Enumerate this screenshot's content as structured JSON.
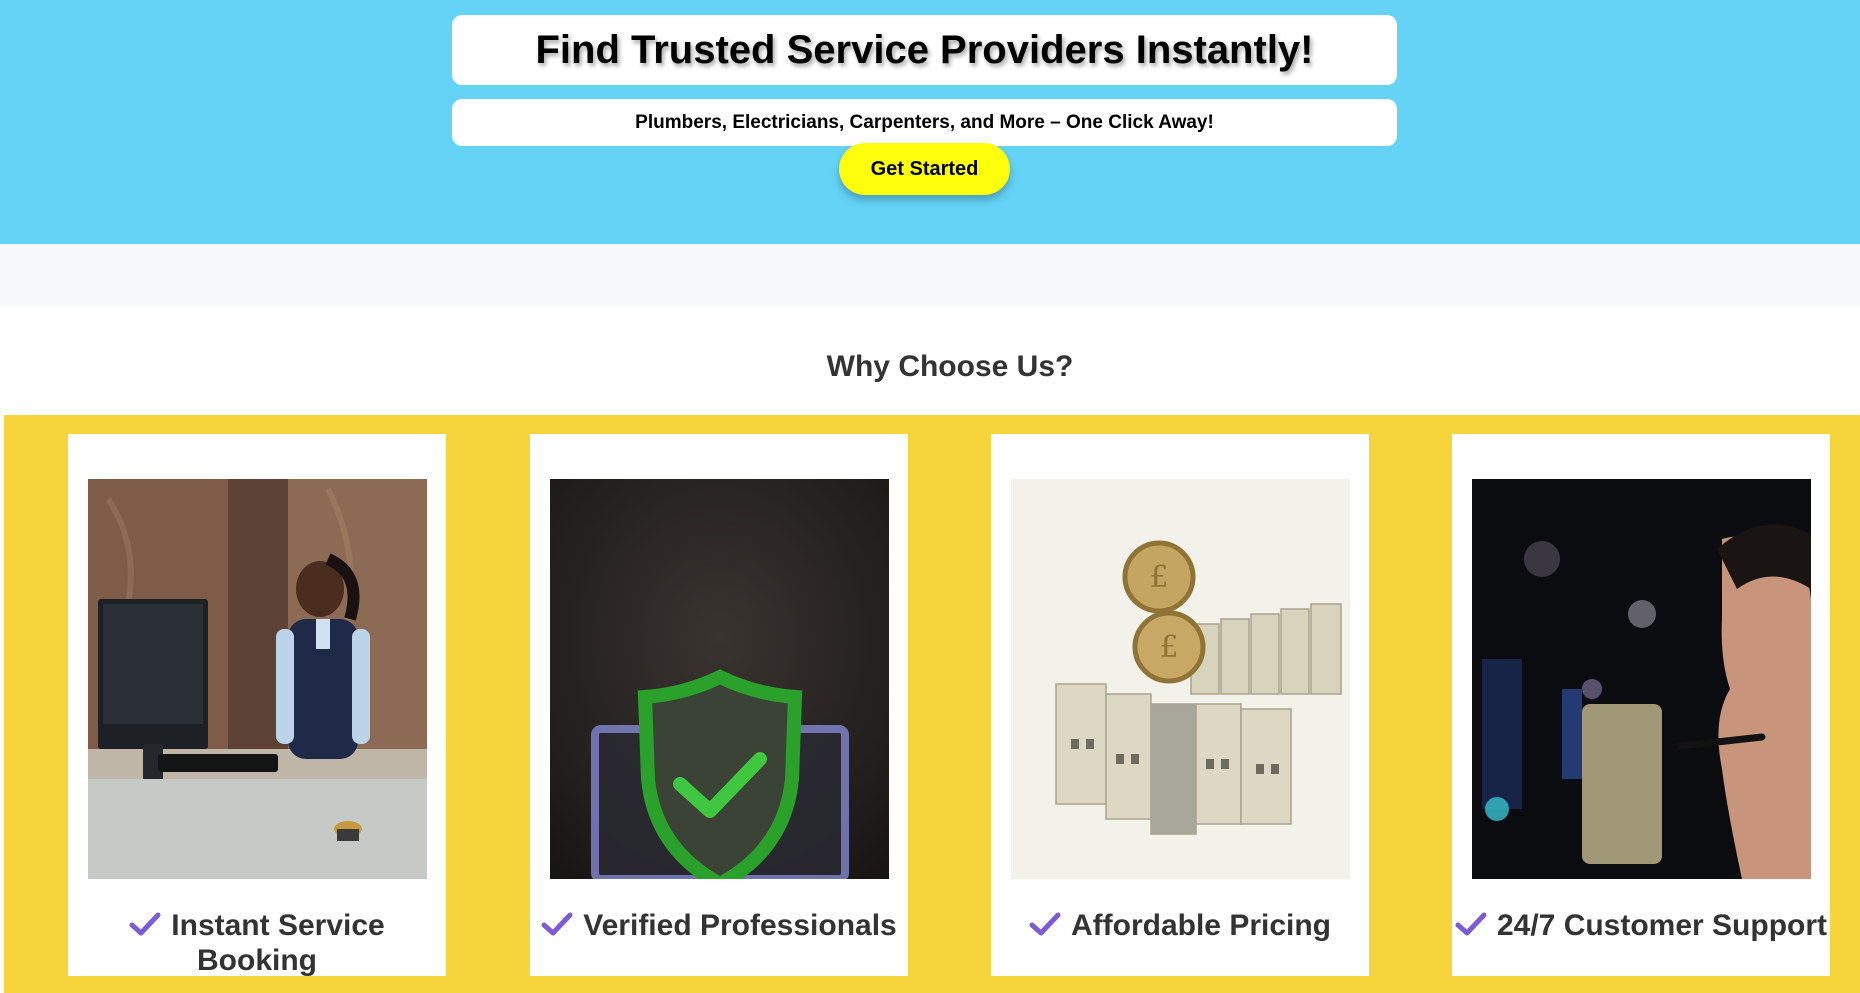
{
  "hero": {
    "title": "Find Trusted Service Providers Instantly!",
    "subtitle": "Plumbers, Electricians, Carpenters, and More – One Click Away!",
    "cta_label": "Get Started",
    "background_color": "#64d3f6",
    "cta_color": "#ffff0d"
  },
  "why": {
    "title": "Why Choose Us?",
    "background_color": "#f6d43c",
    "check_icon": "check-icon",
    "check_color": "#7b5bd6",
    "cards": [
      {
        "label": "Instant Service Booking",
        "image": "receptionist-at-desk-photo"
      },
      {
        "label": "Verified Professionals",
        "image": "green-shield-checkmark-photo"
      },
      {
        "label": "Affordable Pricing",
        "image": "coins-and-model-houses-photo"
      },
      {
        "label": "24/7 Customer Support",
        "image": "support-agent-headset-photo"
      }
    ]
  }
}
